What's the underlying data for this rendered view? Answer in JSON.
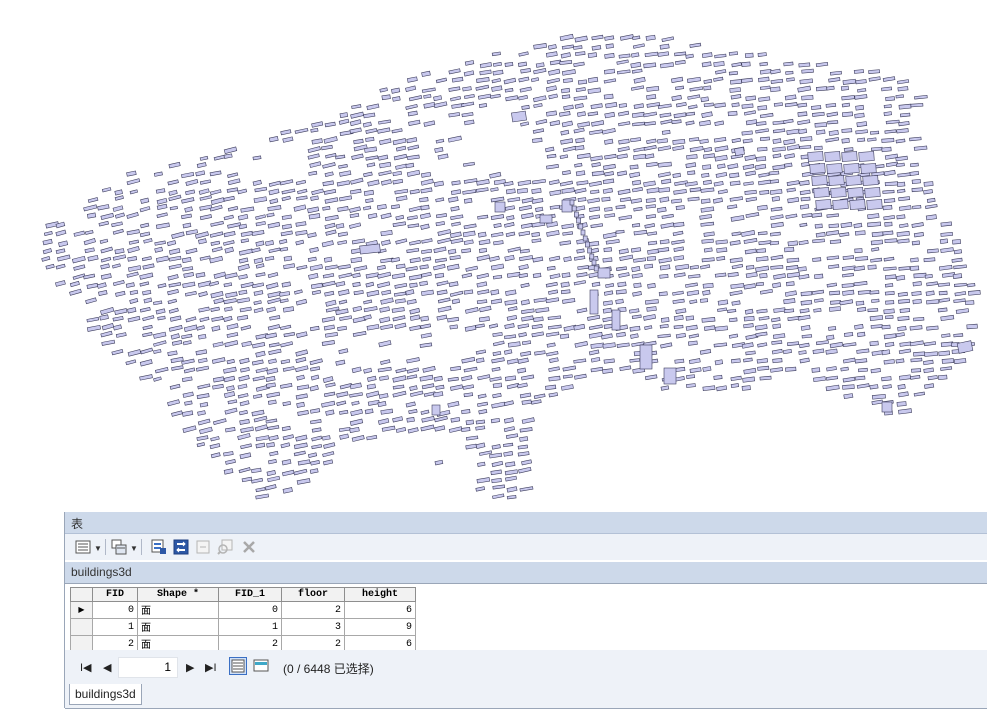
{
  "map": {
    "layer": "buildings3d",
    "fill_color": "#c9c9ee",
    "stroke_color": "#3d3d5c"
  },
  "table": {
    "title": "表",
    "layer_name": "buildings3d",
    "columns": [
      "FID",
      "Shape *",
      "FID_1",
      "floor",
      "height"
    ],
    "rows": [
      {
        "fid": "0",
        "shape": "面",
        "fid_1": "0",
        "floor": "2",
        "height": "6"
      },
      {
        "fid": "1",
        "shape": "面",
        "fid_1": "1",
        "floor": "3",
        "height": "9"
      },
      {
        "fid": "2",
        "shape": "面",
        "fid_1": "2",
        "floor": "2",
        "height": "6"
      }
    ],
    "page_number": "1",
    "status": "(0 / 6448 已选择)",
    "tab_label": "buildings3d"
  },
  "icons": {
    "table_options": "table-options-icon",
    "related_tables": "related-tables-icon",
    "select_by_attributes": "select-by-attributes-icon",
    "switch_selection": "switch-selection-icon",
    "clear_selection": "clear-selection-icon",
    "zoom_to_selected": "zoom-to-selected-icon",
    "delete_selected": "delete-selected-icon"
  }
}
